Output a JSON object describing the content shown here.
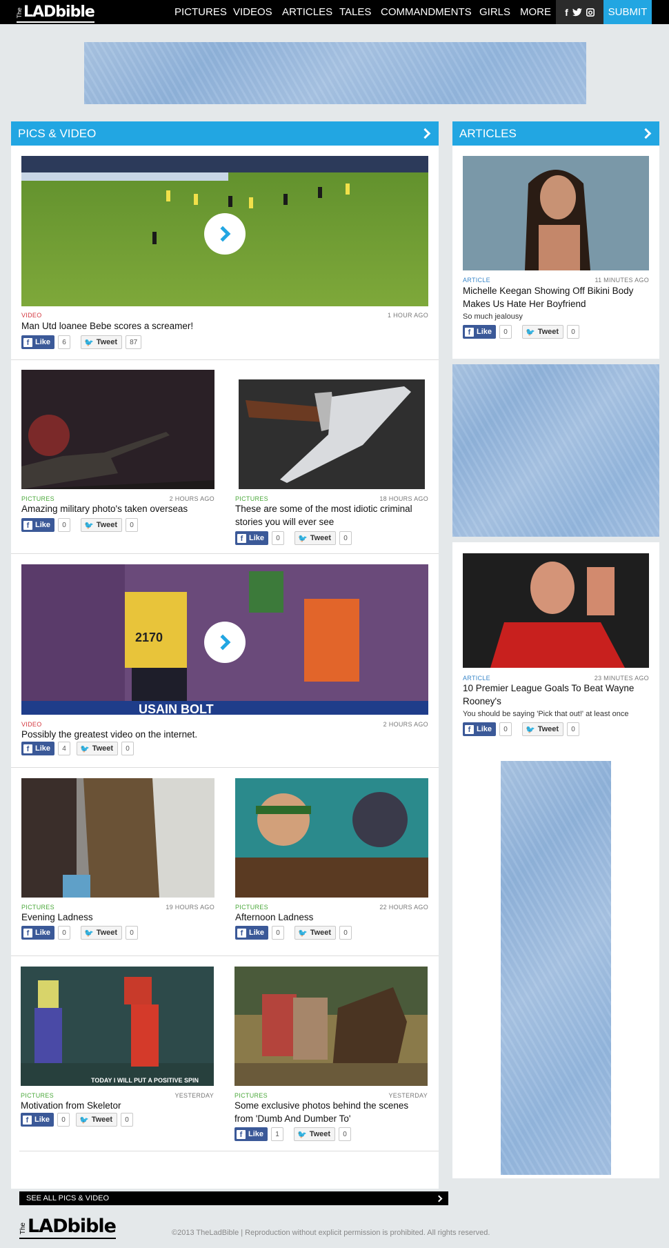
{
  "nav": {
    "logo_the": "The",
    "logo_brand": "LADbible",
    "items": [
      "PICTURES",
      "VIDEOS",
      "ARTICLES",
      "TALES",
      "COMMANDMENTS",
      "GIRLS",
      "MORE"
    ],
    "social_icons": [
      "facebook-icon",
      "twitter-icon",
      "instagram-icon"
    ],
    "submit_label": "SUBMIT"
  },
  "colors": {
    "accent": "#22a6e2",
    "facebook": "#3b5998",
    "video": "#d3343c",
    "pictures": "#4aa83a",
    "article": "#3a87c9"
  },
  "pics_video": {
    "heading": "PICS & VIDEO",
    "items": [
      {
        "category": "VIDEO",
        "time": "1 HOUR AGO",
        "title": "Man Utd loanee Bebe scores a screamer!",
        "likes": "6",
        "tweets": "87"
      },
      {
        "category": "PICTURES",
        "time": "2 HOURS AGO",
        "title": "Amazing military photo's taken overseas",
        "likes": "0",
        "tweets": "0"
      },
      {
        "category": "PICTURES",
        "time": "18 HOURS AGO",
        "title": "These are some of the most idiotic criminal stories you will ever see",
        "likes": "0",
        "tweets": "0"
      },
      {
        "category": "VIDEO",
        "time": "2 HOURS AGO",
        "title": "Possibly the greatest video on the internet.",
        "likes": "4",
        "tweets": "0"
      },
      {
        "category": "PICTURES",
        "time": "19 HOURS AGO",
        "title": "Evening Ladness",
        "likes": "0",
        "tweets": "0"
      },
      {
        "category": "PICTURES",
        "time": "22 HOURS AGO",
        "title": "Afternoon Ladness",
        "likes": "0",
        "tweets": "0"
      },
      {
        "category": "PICTURES",
        "time": "YESTERDAY",
        "title": "Motivation from Skeletor",
        "likes": "0",
        "tweets": "0"
      },
      {
        "category": "PICTURES",
        "time": "YESTERDAY",
        "title": "Some exclusive photos behind the scenes from 'Dumb And Dumber To'",
        "likes": "1",
        "tweets": "0"
      }
    ],
    "image_captions": {
      "bolt_bib": "2170",
      "bolt_banner": "USAIN BOLT",
      "skeletor_caption": "TODAY I WILL PUT A POSITIVE SPIN"
    },
    "see_all": "SEE ALL PICS & VIDEO"
  },
  "articles": {
    "heading": "ARTICLES",
    "items": [
      {
        "category": "ARTICLE",
        "time": "11 MINUTES AGO",
        "title": "Michelle Keegan Showing Off Bikini Body Makes Us Hate Her Boyfriend",
        "desc": "So much jealousy",
        "likes": "0",
        "tweets": "0"
      },
      {
        "category": "ARTICLE",
        "time": "23 MINUTES AGO",
        "title": "10 Premier League Goals To Beat Wayne Rooney's",
        "desc": "You should be saying 'Pick that out!' at least once",
        "likes": "0",
        "tweets": "0"
      }
    ]
  },
  "social_labels": {
    "like": "Like",
    "tweet": "Tweet"
  },
  "footer": {
    "logo_the": "The",
    "logo_brand": "LADbible",
    "copyright": "©2013 TheLadBible | Reproduction without explicit permission is prohibited. All rights reserved."
  }
}
